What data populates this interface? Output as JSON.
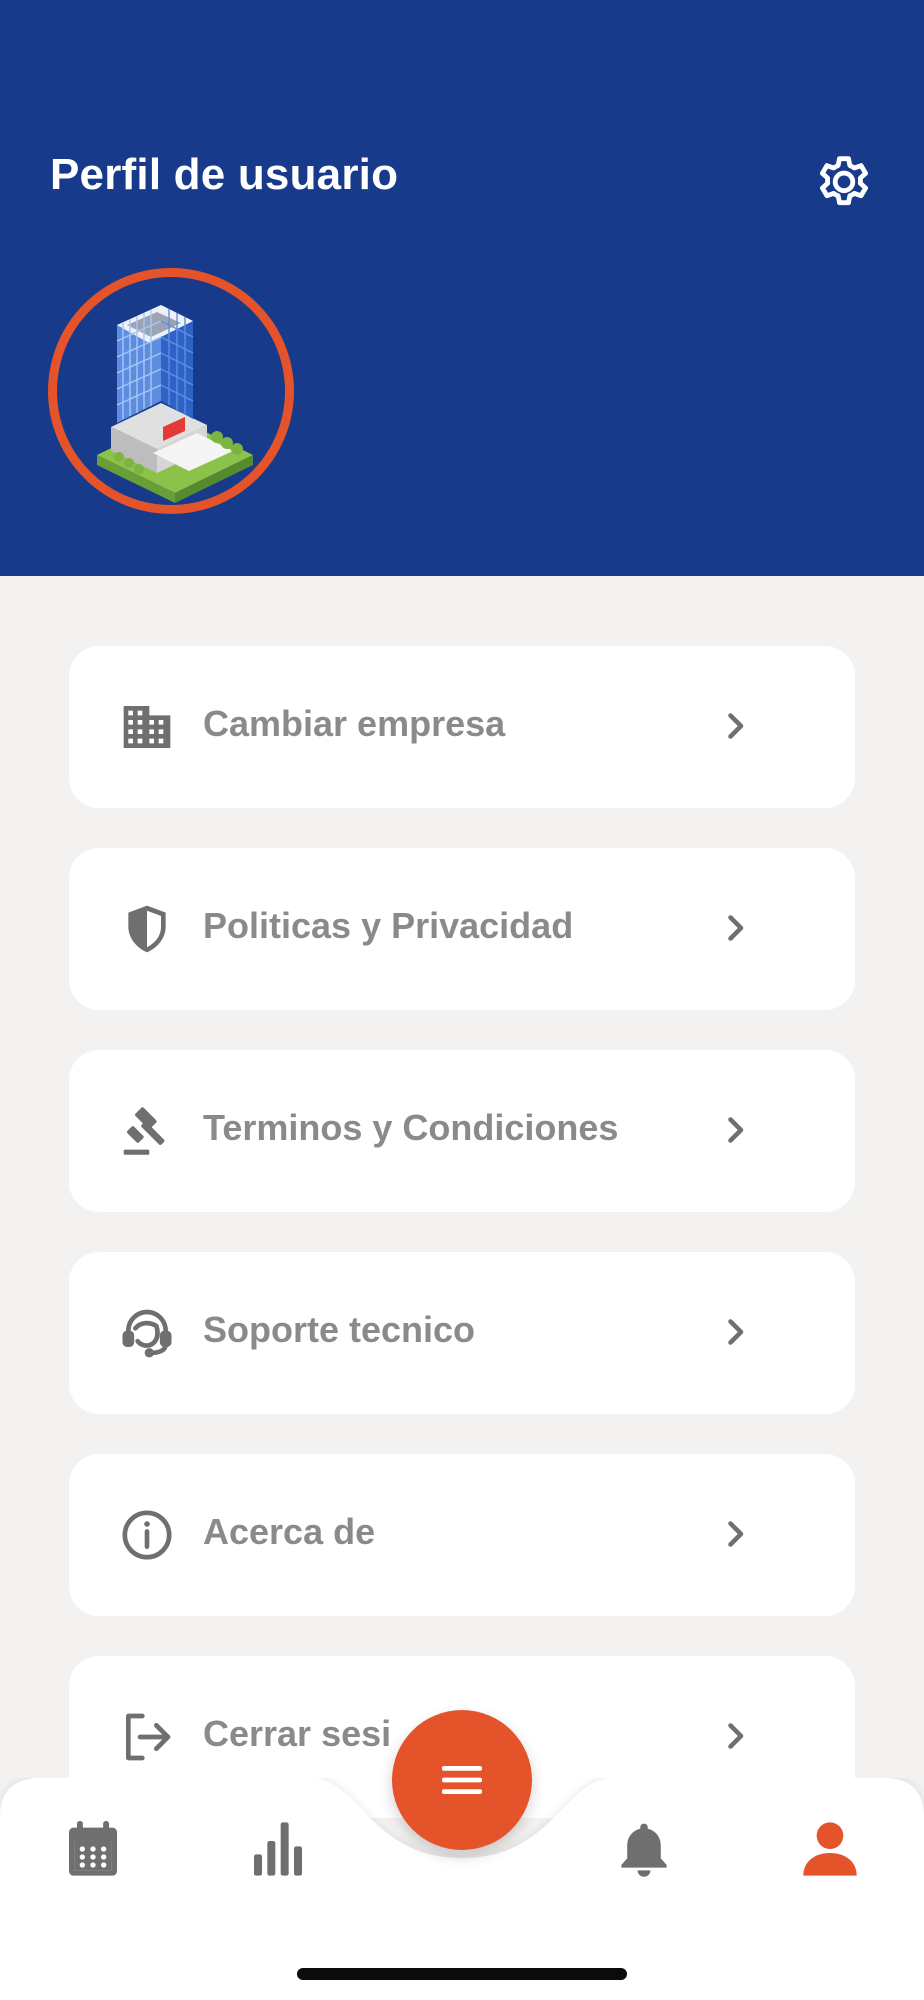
{
  "header": {
    "title": "Perfil de usuario",
    "settings_icon": "gear-icon",
    "avatar_icon": "office-building-illustration"
  },
  "menu": [
    {
      "label": "Cambiar empresa",
      "icon": "building-icon"
    },
    {
      "label": "Politicas y Privacidad",
      "icon": "shield-icon"
    },
    {
      "label": "Terminos y Condiciones",
      "icon": "gavel-icon"
    },
    {
      "label": "Soporte tecnico",
      "icon": "support-agent-icon"
    },
    {
      "label": "Acerca de",
      "icon": "info-icon"
    },
    {
      "label": "Cerrar sesi",
      "icon": "logout-icon"
    }
  ],
  "bottom_nav": {
    "items": [
      "calendar-icon",
      "bar-chart-icon",
      "bell-icon",
      "user-icon"
    ],
    "active": "user-icon",
    "fab_icon": "menu-icon"
  },
  "colors": {
    "header_bg": "#173a8b",
    "accent": "#e4532a",
    "page_bg": "#f3f2f1",
    "icon_gray": "#6f6f6f",
    "label_gray": "#8a8a8a"
  }
}
